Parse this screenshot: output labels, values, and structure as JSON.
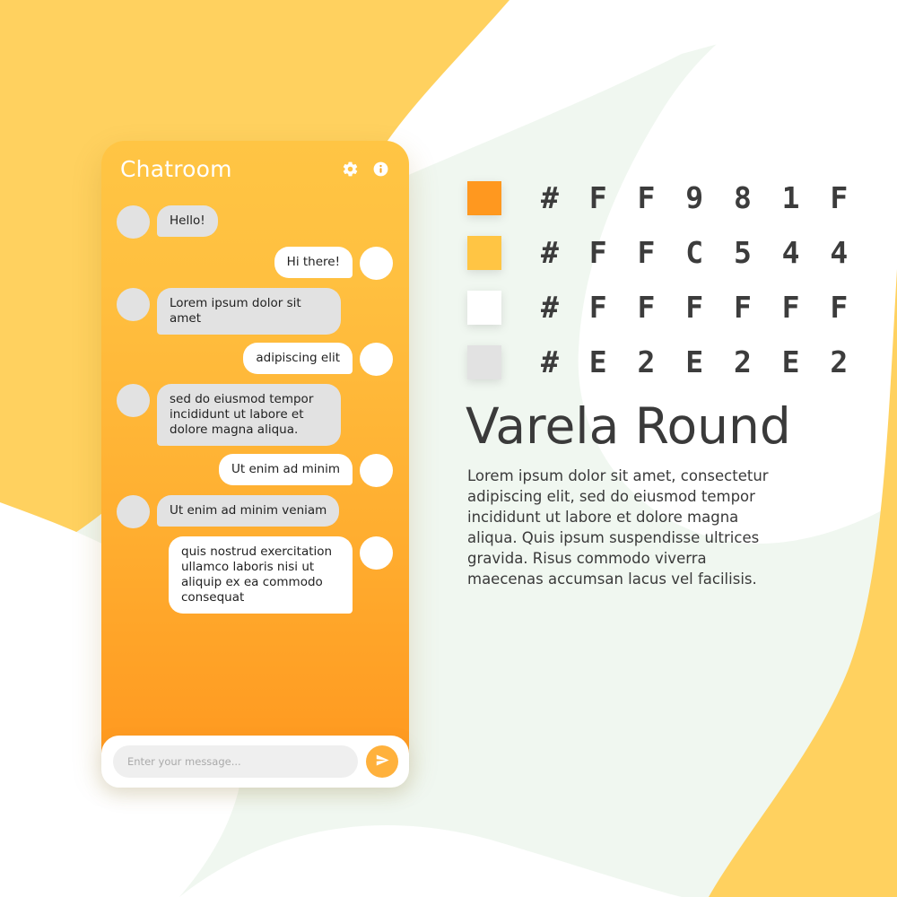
{
  "background": {
    "base_color": "#FFFFFF",
    "mint_tint": "#F0F7F0",
    "yellow_blob": "#FFD15F",
    "white_blob": "#FFFFFF"
  },
  "phone": {
    "header": {
      "title": "Chatroom",
      "settings_icon": "gear-icon",
      "info_icon": "info-icon",
      "title_color": "#FFFFFF"
    },
    "gradient_top": "#FFC544",
    "gradient_bottom": "#FF981F",
    "messages": [
      {
        "side": "incoming",
        "text": "Hello!",
        "avatar": "gray",
        "multiline": false
      },
      {
        "side": "outgoing",
        "text": "Hi there!",
        "avatar": "white",
        "multiline": false
      },
      {
        "side": "incoming",
        "text": "Lorem ipsum dolor sit amet",
        "avatar": "gray",
        "multiline": false
      },
      {
        "side": "outgoing",
        "text": "adipiscing elit",
        "avatar": "white",
        "multiline": false
      },
      {
        "side": "incoming",
        "text": "sed do eiusmod tempor incididunt ut labore et dolore magna aliqua.",
        "avatar": "gray",
        "multiline": true
      },
      {
        "side": "outgoing",
        "text": "Ut enim ad minim",
        "avatar": "white",
        "multiline": false
      },
      {
        "side": "incoming",
        "text": "Ut enim ad minim veniam",
        "avatar": "gray",
        "multiline": false
      },
      {
        "side": "outgoing",
        "text": "quis nostrud exercitation ullamco laboris nisi ut aliquip ex ea commodo consequat",
        "avatar": "white",
        "multiline": true
      }
    ],
    "input_bar": {
      "placeholder": "Enter your message...",
      "value": "",
      "send_icon": "send-paper-plane-icon",
      "send_button_color": "#FFB13C"
    }
  },
  "palette": {
    "swatches": [
      {
        "hex": "#FF981F",
        "label": "# F F 9 8 1 F"
      },
      {
        "hex": "#FFC544",
        "label": "# F F C 5 4 4"
      },
      {
        "hex": "#FFFFFF",
        "label": "# F F F F F F"
      },
      {
        "hex": "#E2E2E2",
        "label": "# E 2 E 2 E 2"
      }
    ]
  },
  "typography": {
    "font_name": "Varela Round",
    "sample_text": "Lorem ipsum dolor sit amet, consectetur adipiscing elit, sed do eiusmod tempor incididunt ut labore et dolore magna aliqua. Quis ipsum suspendisse ultrices gravida. Risus commodo viverra maecenas accumsan lacus vel facilisis.",
    "text_color": "#3A3A3A"
  }
}
